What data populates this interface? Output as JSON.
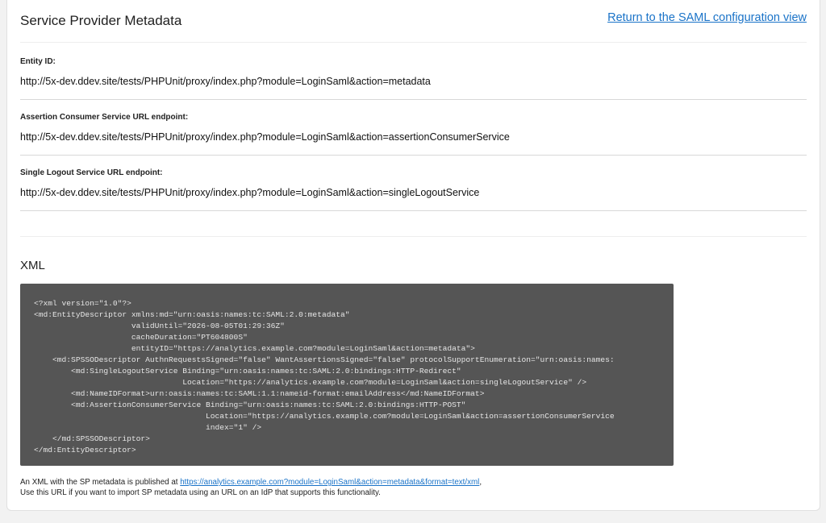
{
  "header": {
    "title": "Service Provider Metadata",
    "return_link": "Return to the SAML configuration view"
  },
  "fields": [
    {
      "label": "Entity ID:",
      "value": "http://5x-dev.ddev.site/tests/PHPUnit/proxy/index.php?module=LoginSaml&action=metadata"
    },
    {
      "label": "Assertion Consumer Service URL endpoint:",
      "value": "http://5x-dev.ddev.site/tests/PHPUnit/proxy/index.php?module=LoginSaml&action=assertionConsumerService"
    },
    {
      "label": "Single Logout Service URL endpoint:",
      "value": "http://5x-dev.ddev.site/tests/PHPUnit/proxy/index.php?module=LoginSaml&action=singleLogoutService"
    }
  ],
  "xml": {
    "title": "XML",
    "content": "<?xml version=\"1.0\"?>\n<md:EntityDescriptor xmlns:md=\"urn:oasis:names:tc:SAML:2.0:metadata\"\n                     validUntil=\"2026-08-05T01:29:36Z\"\n                     cacheDuration=\"PT604800S\"\n                     entityID=\"https://analytics.example.com?module=LoginSaml&action=metadata\">\n    <md:SPSSODescriptor AuthnRequestsSigned=\"false\" WantAssertionsSigned=\"false\" protocolSupportEnumeration=\"urn:oasis:names:\n        <md:SingleLogoutService Binding=\"urn:oasis:names:tc:SAML:2.0:bindings:HTTP-Redirect\"\n                                Location=\"https://analytics.example.com?module=LoginSaml&action=singleLogoutService\" />\n        <md:NameIDFormat>urn:oasis:names:tc:SAML:1.1:nameid-format:emailAddress</md:NameIDFormat>\n        <md:AssertionConsumerService Binding=\"urn:oasis:names:tc:SAML:2.0:bindings:HTTP-POST\"\n                                     Location=\"https://analytics.example.com?module=LoginSaml&action=assertionConsumerService\n                                     index=\"1\" />\n    </md:SPSSODescriptor>\n</md:EntityDescriptor>"
  },
  "note": {
    "prefix": "An XML with the SP metadata is published at ",
    "link": "https://analytics.example.com?module=LoginSaml&action=metadata&format=text/xml",
    "suffix": ",",
    "line2": "Use this URL if you want to import SP metadata using an URL on an IdP that supports this functionality."
  }
}
